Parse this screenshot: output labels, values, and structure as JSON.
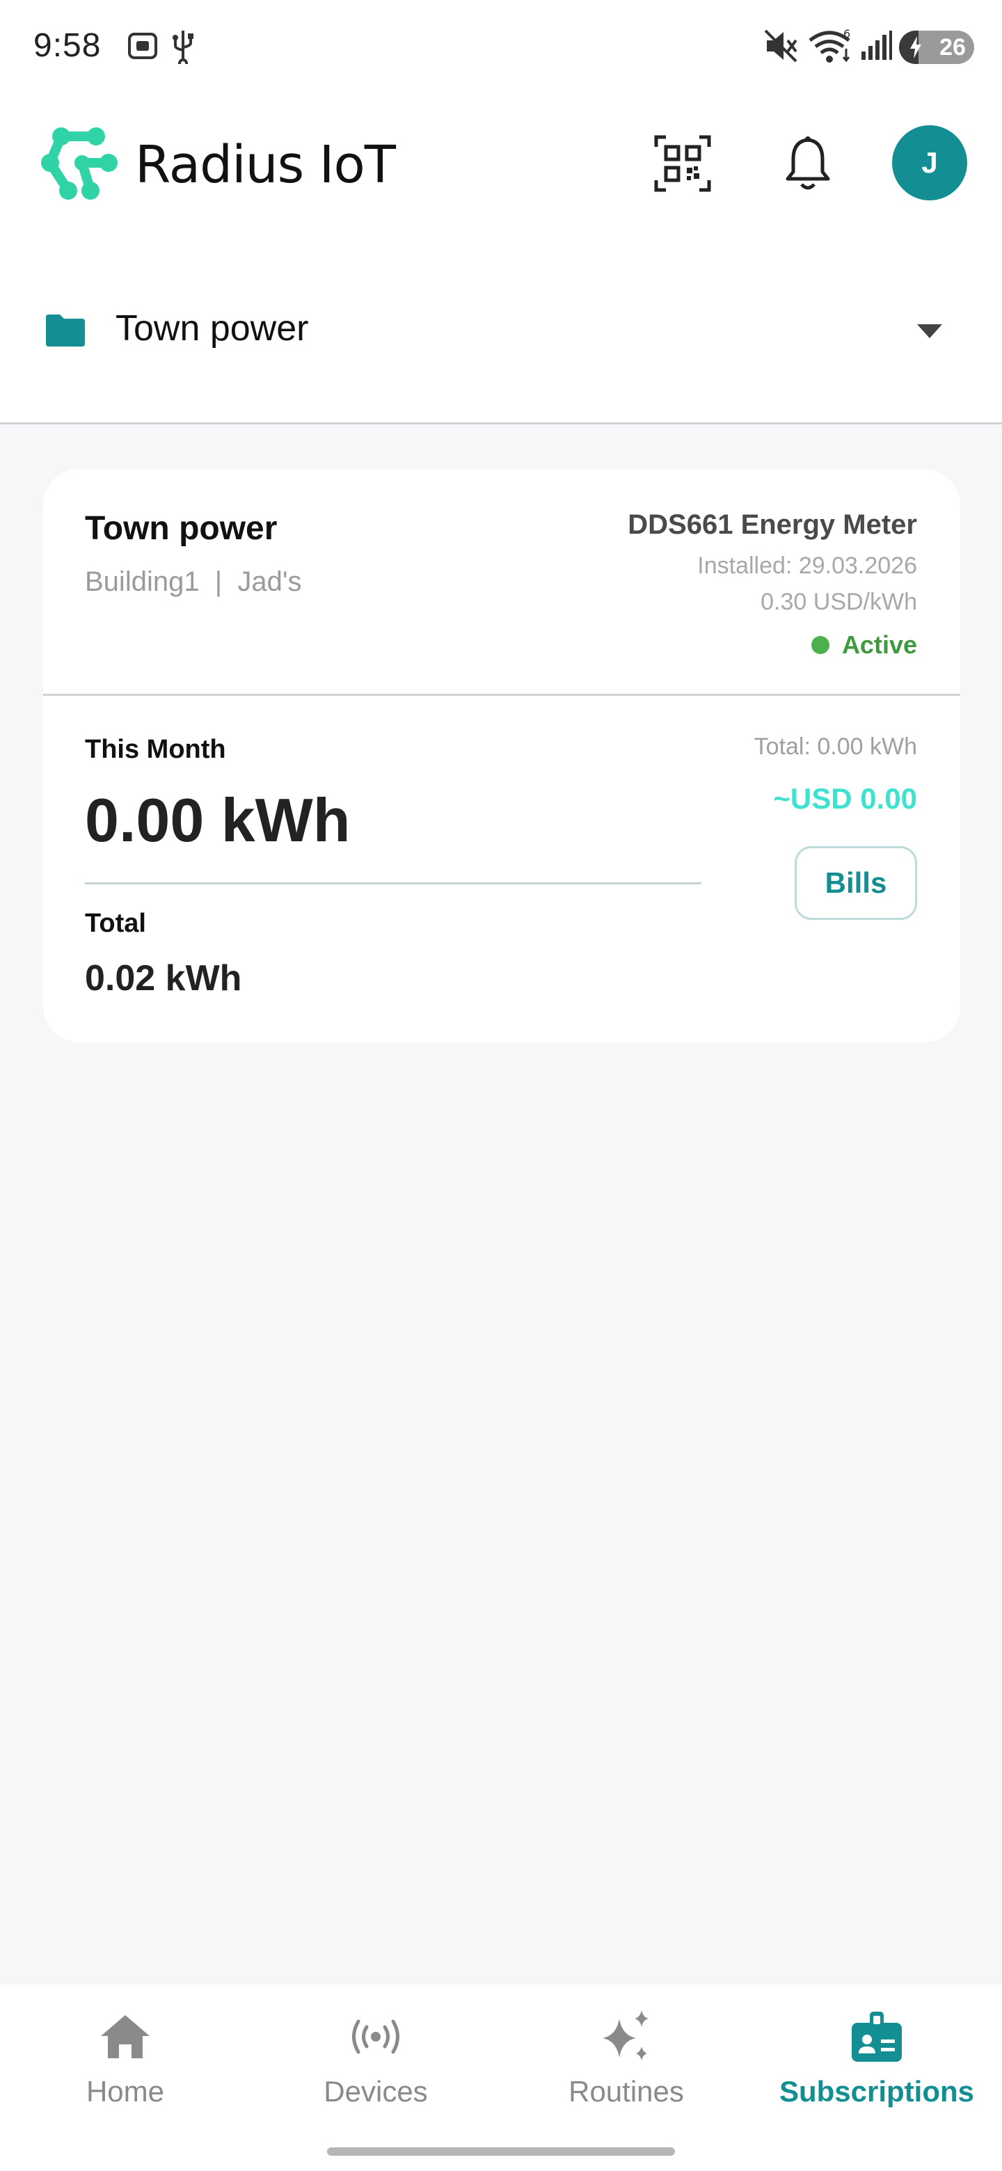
{
  "status_bar": {
    "time": "9:58",
    "battery": "26",
    "battery_percent": 26,
    "wifi_badge": "6"
  },
  "header": {
    "app_name": "Radius IoT",
    "avatar_initial": "J",
    "brand_color": "#138f93",
    "logo_color": "#2fd3a6"
  },
  "folder": {
    "name": "Town power"
  },
  "card": {
    "title": "Town power",
    "subtitle": "Building1  |  Jad's",
    "device": "DDS661 Energy Meter",
    "installed": "Installed: 29.03.2026",
    "rate": "0.30 USD/kWh",
    "status": "Active",
    "status_color": "#4cb04c",
    "this_month_label": "This Month",
    "this_month_value": "0.00 kWh",
    "total_label": "Total",
    "total_value": "0.02 kWh",
    "total_summary": "Total: 0.00 kWh",
    "cost": "~USD 0.00",
    "bills_label": "Bills"
  },
  "bottom_nav": {
    "items": [
      {
        "label": "Home",
        "icon": "home-icon"
      },
      {
        "label": "Devices",
        "icon": "broadcast-icon"
      },
      {
        "label": "Routines",
        "icon": "sparkle-icon"
      },
      {
        "label": "Subscriptions",
        "icon": "id-badge-icon"
      }
    ],
    "active": "Subscriptions"
  }
}
